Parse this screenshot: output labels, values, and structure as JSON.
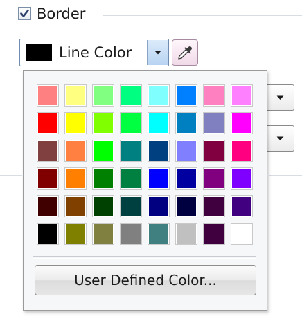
{
  "border": {
    "checked": true,
    "label": "Border"
  },
  "line_color": {
    "label": "Line Color",
    "current_color": "#000000"
  },
  "icons": {
    "checkbox": "checkmark-icon",
    "dropdown": "chevron-down-icon",
    "eyedropper": "eyedropper-icon"
  },
  "palette": {
    "rows": [
      [
        "#ff8080",
        "#ffff80",
        "#80ff80",
        "#00ff80",
        "#80ffff",
        "#0080ff",
        "#ff80c0",
        "#ff80ff"
      ],
      [
        "#ff0000",
        "#ffff00",
        "#80ff00",
        "#00ff40",
        "#00ffff",
        "#0080c0",
        "#8080c0",
        "#ff00ff"
      ],
      [
        "#804040",
        "#ff8040",
        "#00ff00",
        "#008080",
        "#004080",
        "#8080ff",
        "#800040",
        "#ff0080"
      ],
      [
        "#800000",
        "#ff8000",
        "#008000",
        "#008040",
        "#0000ff",
        "#0000a0",
        "#800080",
        "#8000ff"
      ],
      [
        "#400000",
        "#804000",
        "#004000",
        "#004040",
        "#000080",
        "#000040",
        "#400040",
        "#400080"
      ],
      [
        "#000000",
        "#808000",
        "#808040",
        "#808080",
        "#408080",
        "#c0c0c0",
        "#400040",
        "#ffffff"
      ]
    ]
  },
  "user_defined_button": {
    "label": "User Defined Color..."
  }
}
